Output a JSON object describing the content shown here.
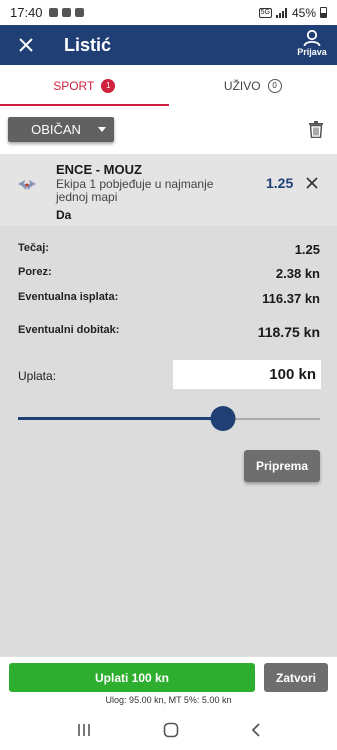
{
  "status_bar": {
    "time": "17:40",
    "network": "5G",
    "battery": "45%"
  },
  "app_bar": {
    "title": "Listić",
    "login_label": "Prijava",
    "close_icon": "close-icon",
    "login_icon": "user-icon"
  },
  "tabs": [
    {
      "label": "SPORT",
      "count": "1",
      "active": true
    },
    {
      "label": "UŽIVO",
      "count": "0",
      "active": false
    }
  ],
  "toolbar": {
    "ticket_type": "OBIČAN",
    "trash_icon": "trash-icon"
  },
  "bet": {
    "match": "ENCE - MOUZ",
    "market": "Ekipa 1 pobjeđuje u najmanje jednoj mapi",
    "pick": "Da",
    "odd": "1.25",
    "sport_icon": "esports-icon"
  },
  "summary": {
    "odds_label": "Tečaj:",
    "odds_value": "1.25",
    "tax_label": "Porez:",
    "tax_value": "2.38 kn",
    "payout_label": "Eventualna isplata:",
    "payout_value": "116.37 kn",
    "win_label": "Eventualni dobitak:",
    "win_value": "118.75 kn"
  },
  "stake": {
    "label": "Uplata:",
    "value": "100 kn",
    "slider_fraction": 0.68
  },
  "prepare_label": "Priprema",
  "footer": {
    "pay_label": "Uplati 100 kn",
    "close_label": "Zatvori",
    "note": "Ulog: 95.00 kn, MT 5%: 5.00 kn"
  },
  "colors": {
    "primary": "#1f3f75",
    "accent_red": "#d0213c",
    "pay_green": "#2eae2f",
    "grey_button": "#6e6e6e"
  }
}
